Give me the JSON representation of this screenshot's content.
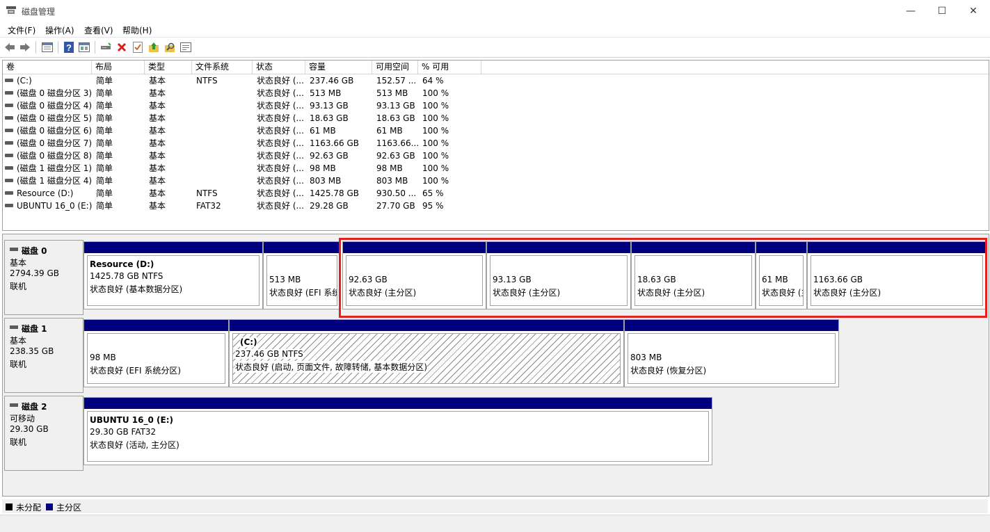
{
  "window": {
    "title": "磁盘管理",
    "minimize_glyph": "—",
    "maximize_glyph": "☐",
    "close_glyph": "✕"
  },
  "menu": [
    "文件(F)",
    "操作(A)",
    "查看(V)",
    "帮助(H)"
  ],
  "toolbar": {
    "icons": [
      "back-icon",
      "forward-icon",
      "view-panel-icon",
      "help-icon",
      "properties-icon",
      "connect-disk-icon",
      "delete-icon",
      "check-icon",
      "up-folder-icon",
      "search-folder-icon",
      "console-icon"
    ],
    "delete_color": "#d81e1e",
    "help_color": "#3355aa"
  },
  "columns": [
    "卷",
    "布局",
    "类型",
    "文件系统",
    "状态",
    "容量",
    "可用空间",
    "% 可用"
  ],
  "volumes": [
    {
      "name": "(C:)",
      "layout": "简单",
      "type": "基本",
      "fs": "NTFS",
      "status": "状态良好 (...",
      "capacity": "237.46 GB",
      "free": "152.57 ...",
      "pct": "64 %"
    },
    {
      "name": "(磁盘 0 磁盘分区 3)",
      "layout": "简单",
      "type": "基本",
      "fs": "",
      "status": "状态良好 (...",
      "capacity": "513 MB",
      "free": "513 MB",
      "pct": "100 %"
    },
    {
      "name": "(磁盘 0 磁盘分区 4)",
      "layout": "简单",
      "type": "基本",
      "fs": "",
      "status": "状态良好 (...",
      "capacity": "93.13 GB",
      "free": "93.13 GB",
      "pct": "100 %"
    },
    {
      "name": "(磁盘 0 磁盘分区 5)",
      "layout": "简单",
      "type": "基本",
      "fs": "",
      "status": "状态良好 (...",
      "capacity": "18.63 GB",
      "free": "18.63 GB",
      "pct": "100 %"
    },
    {
      "name": "(磁盘 0 磁盘分区 6)",
      "layout": "简单",
      "type": "基本",
      "fs": "",
      "status": "状态良好 (...",
      "capacity": "61 MB",
      "free": "61 MB",
      "pct": "100 %"
    },
    {
      "name": "(磁盘 0 磁盘分区 7)",
      "layout": "简单",
      "type": "基本",
      "fs": "",
      "status": "状态良好 (...",
      "capacity": "1163.66 GB",
      "free": "1163.66...",
      "pct": "100 %"
    },
    {
      "name": "(磁盘 0 磁盘分区 8)",
      "layout": "简单",
      "type": "基本",
      "fs": "",
      "status": "状态良好 (...",
      "capacity": "92.63 GB",
      "free": "92.63 GB",
      "pct": "100 %"
    },
    {
      "name": "(磁盘 1 磁盘分区 1)",
      "layout": "简单",
      "type": "基本",
      "fs": "",
      "status": "状态良好 (...",
      "capacity": "98 MB",
      "free": "98 MB",
      "pct": "100 %"
    },
    {
      "name": "(磁盘 1 磁盘分区 4)",
      "layout": "简单",
      "type": "基本",
      "fs": "",
      "status": "状态良好 (...",
      "capacity": "803 MB",
      "free": "803 MB",
      "pct": "100 %"
    },
    {
      "name": "Resource (D:)",
      "layout": "简单",
      "type": "基本",
      "fs": "NTFS",
      "status": "状态良好 (...",
      "capacity": "1425.78 GB",
      "free": "930.50 ...",
      "pct": "65 %"
    },
    {
      "name": "UBUNTU 16_0 (E:)",
      "layout": "简单",
      "type": "基本",
      "fs": "FAT32",
      "status": "状态良好 (...",
      "capacity": "29.28 GB",
      "free": "27.70 GB",
      "pct": "95 %"
    }
  ],
  "disks": [
    {
      "name": "磁盘 0",
      "kind": "基本",
      "size": "2794.39 GB",
      "state": "联机",
      "partitions": [
        {
          "label": "Resource  (D:)",
          "size": "1425.78 GB NTFS",
          "status": "状态良好 (基本数据分区)"
        },
        {
          "label": "",
          "size": "513 MB",
          "status": "状态良好 (EFI 系统分区)"
        },
        {
          "label": "",
          "size": "92.63 GB",
          "status": "状态良好 (主分区)"
        },
        {
          "label": "",
          "size": "93.13 GB",
          "status": "状态良好 (主分区)"
        },
        {
          "label": "",
          "size": "18.63 GB",
          "status": "状态良好 (主分区)"
        },
        {
          "label": "",
          "size": "61 MB",
          "status": "状态良好 (主分区)"
        },
        {
          "label": "",
          "size": "1163.66 GB",
          "status": "状态良好 (主分区)"
        }
      ]
    },
    {
      "name": "磁盘 1",
      "kind": "基本",
      "size": "238.35 GB",
      "state": "联机",
      "partitions": [
        {
          "label": "",
          "size": "98 MB",
          "status": "状态良好 (EFI 系统分区)"
        },
        {
          "label": "(C:)",
          "size": "237.46 GB NTFS",
          "status": "状态良好 (启动, 页面文件, 故障转储, 基本数据分区)"
        },
        {
          "label": "",
          "size": "803 MB",
          "status": "状态良好 (恢复分区)"
        }
      ]
    },
    {
      "name": "磁盘 2",
      "kind": "可移动",
      "size": "29.30 GB",
      "state": "联机",
      "partitions": [
        {
          "label": "UBUNTU 16_0  (E:)",
          "size": "29.30 GB FAT32",
          "status": "状态良好 (活动, 主分区)"
        }
      ]
    }
  ],
  "legend": [
    {
      "label": "未分配",
      "color": "#000000"
    },
    {
      "label": "主分区",
      "color": "#00007f"
    }
  ],
  "colors": {
    "partition_bar": "#00007f",
    "highlight": "#e22222"
  }
}
